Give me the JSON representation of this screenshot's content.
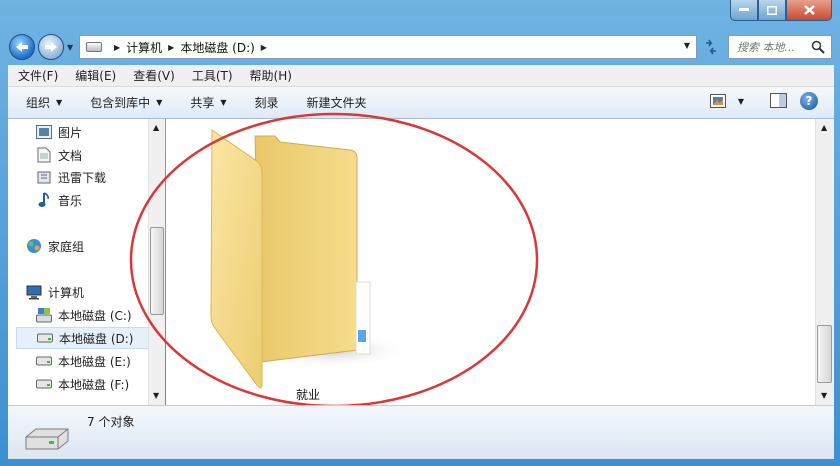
{
  "address": {
    "breadcrumbs": [
      "计算机",
      "本地磁盘 (D:)"
    ]
  },
  "search": {
    "placeholder": "搜索 本地..."
  },
  "menu": [
    "文件(F)",
    "编辑(E)",
    "查看(V)",
    "工具(T)",
    "帮助(H)"
  ],
  "toolbar": {
    "organize": "组织",
    "include_library": "包含到库中",
    "share": "共享",
    "burn": "刻录",
    "new_folder": "新建文件夹"
  },
  "nav_pane": {
    "pictures": "图片",
    "documents": "文档",
    "xunlei": "迅雷下载",
    "music": "音乐",
    "homegroup": "家庭组",
    "computer": "计算机",
    "drive_c": "本地磁盘 (C:)",
    "drive_d": "本地磁盘 (D:)",
    "drive_e": "本地磁盘 (E:)",
    "drive_f": "本地磁盘 (F:)"
  },
  "content": {
    "folder_name": "就业"
  },
  "status": {
    "count_text": "7 个对象"
  },
  "colors": {
    "annotation_circle": "#d9383a",
    "folder": "#f3d57c",
    "titlebar": "#4a9ad6"
  }
}
